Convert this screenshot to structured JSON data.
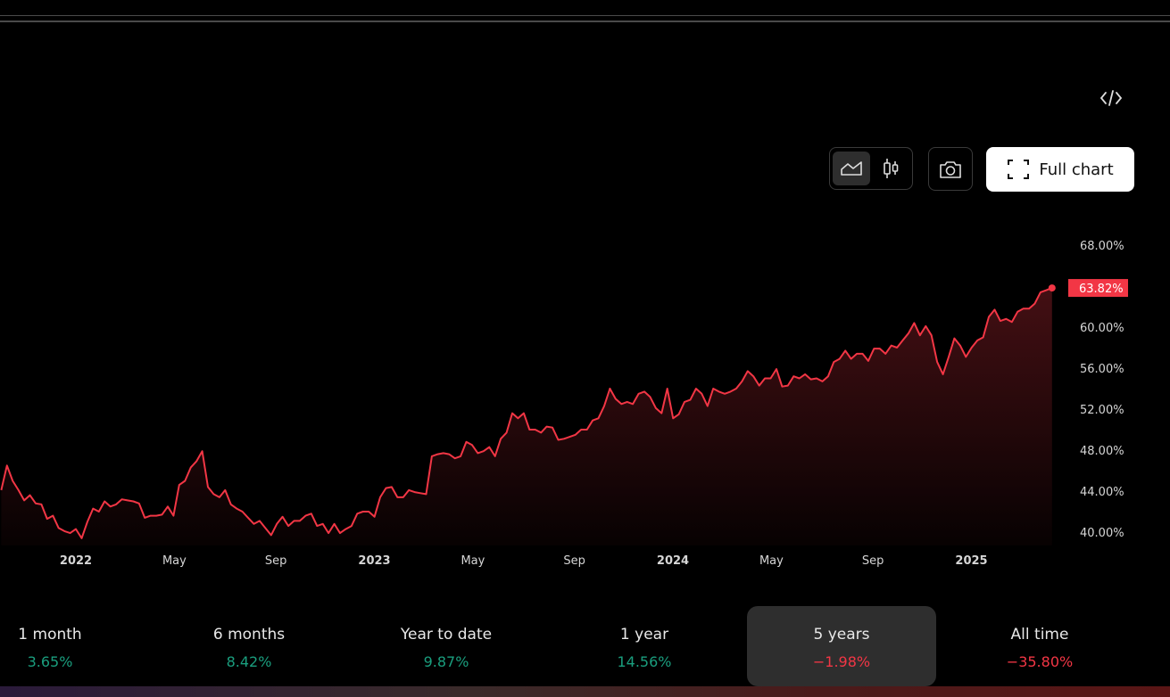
{
  "toolbar": {
    "full_chart_label": "Full chart",
    "embed_icon": "code-icon",
    "area_icon": "area-chart-icon",
    "candle_icon": "candlestick-icon",
    "camera_icon": "camera-icon",
    "fullscreen_icon": "fullscreen-icon"
  },
  "colors": {
    "line": "#f23645",
    "positive": "#1a9e7e",
    "negative": "#f23645"
  },
  "chart_data": {
    "type": "area",
    "x_start": 2021.75,
    "x_end": 2025.27,
    "interval": "weekly",
    "ylim": [
      39,
      69.5
    ],
    "ylabel": "",
    "xlabel": "",
    "y_ticks": [
      "40.00%",
      "44.00%",
      "48.00%",
      "52.00%",
      "56.00%",
      "60.00%",
      "64.00%",
      "68.00%"
    ],
    "y_tick_values": [
      40,
      44,
      48,
      52,
      56,
      60,
      64,
      68
    ],
    "x_ticks": [
      {
        "label": "2022",
        "value": 2022.0,
        "bold": true
      },
      {
        "label": "May",
        "value": 2022.33,
        "bold": false
      },
      {
        "label": "Sep",
        "value": 2022.67,
        "bold": false
      },
      {
        "label": "2023",
        "value": 2023.0,
        "bold": true
      },
      {
        "label": "May",
        "value": 2023.33,
        "bold": false
      },
      {
        "label": "Sep",
        "value": 2023.67,
        "bold": false
      },
      {
        "label": "2024",
        "value": 2024.0,
        "bold": true
      },
      {
        "label": "May",
        "value": 2024.33,
        "bold": false
      },
      {
        "label": "Sep",
        "value": 2024.67,
        "bold": false
      },
      {
        "label": "2025",
        "value": 2025.0,
        "bold": true
      }
    ],
    "last_value_label": "63.82%",
    "last_value": 63.82,
    "values": [
      44.1,
      46.5,
      45.0,
      44.1,
      43.1,
      43.6,
      42.8,
      42.7,
      41.3,
      41.6,
      40.4,
      40.1,
      39.9,
      40.3,
      39.4,
      41.0,
      42.3,
      42.0,
      43.0,
      42.5,
      42.7,
      43.2,
      43.1,
      43.0,
      42.8,
      41.4,
      41.6,
      41.6,
      41.7,
      42.5,
      41.6,
      44.6,
      45.0,
      46.3,
      46.9,
      47.9,
      44.4,
      43.7,
      43.4,
      44.1,
      42.7,
      42.3,
      42.0,
      41.4,
      40.8,
      41.1,
      40.4,
      39.7,
      40.8,
      41.5,
      40.6,
      41.1,
      41.1,
      41.6,
      41.8,
      40.6,
      40.8,
      39.9,
      40.8,
      39.9,
      40.3,
      40.6,
      41.8,
      42.0,
      42.0,
      41.5,
      43.4,
      44.3,
      44.4,
      43.4,
      43.4,
      44.1,
      43.9,
      43.8,
      43.7,
      47.4,
      47.6,
      47.7,
      47.6,
      47.2,
      47.4,
      48.8,
      48.5,
      47.7,
      47.9,
      48.3,
      47.4,
      49.1,
      49.7,
      51.6,
      51.1,
      51.6,
      50.0,
      50.0,
      49.7,
      50.3,
      50.2,
      49.0,
      49.1,
      49.3,
      49.5,
      50.0,
      50.0,
      50.9,
      51.1,
      52.3,
      54.0,
      53.0,
      52.5,
      52.7,
      52.5,
      53.5,
      53.7,
      53.2,
      52.1,
      51.6,
      54.0,
      51.1,
      51.5,
      52.7,
      52.9,
      54.0,
      53.5,
      52.3,
      54.0,
      53.7,
      53.5,
      53.7,
      54.0,
      54.7,
      55.7,
      55.2,
      54.3,
      55.0,
      55.0,
      55.9,
      54.2,
      54.3,
      55.2,
      55.0,
      55.4,
      54.9,
      55.0,
      54.7,
      55.2,
      56.6,
      56.9,
      57.7,
      56.9,
      57.4,
      57.4,
      56.7,
      57.9,
      57.9,
      57.4,
      58.2,
      58.0,
      58.7,
      59.4,
      60.4,
      59.2,
      60.1,
      59.2,
      56.6,
      55.4,
      57.1,
      58.9,
      58.2,
      57.1,
      58.0,
      58.7,
      59.0,
      61.0,
      61.7,
      60.6,
      60.8,
      60.5,
      61.5,
      61.8,
      61.8,
      62.3,
      63.4,
      63.6,
      63.82
    ]
  },
  "periods": [
    {
      "label": "1 month",
      "value": "3.65%",
      "sign": "pos",
      "active": false
    },
    {
      "label": "6 months",
      "value": "8.42%",
      "sign": "pos",
      "active": false
    },
    {
      "label": "Year to date",
      "value": "9.87%",
      "sign": "pos",
      "active": false
    },
    {
      "label": "1 year",
      "value": "14.56%",
      "sign": "pos",
      "active": false
    },
    {
      "label": "5 years",
      "value": "−1.98%",
      "sign": "neg",
      "active": true
    },
    {
      "label": "All time",
      "value": "−35.80%",
      "sign": "neg",
      "active": false
    }
  ]
}
